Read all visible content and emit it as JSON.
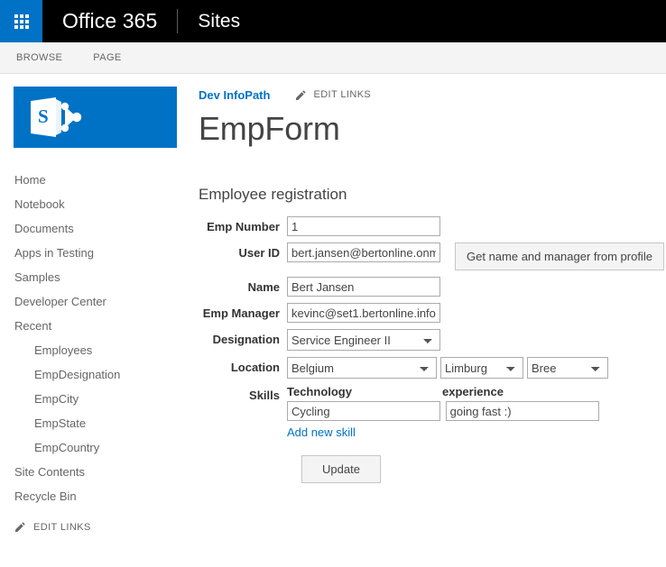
{
  "suite_bar": {
    "waffle_icon": "app-launcher-waffle-icon",
    "brand": "Office 365",
    "nav_item": "Sites"
  },
  "ribbon": {
    "tabs": [
      {
        "label": "BROWSE"
      },
      {
        "label": "PAGE"
      }
    ]
  },
  "logo": {
    "name": "sharepoint-logo",
    "letter": "S"
  },
  "sidebar": {
    "items": [
      {
        "label": "Home",
        "sub": false
      },
      {
        "label": "Notebook",
        "sub": false
      },
      {
        "label": "Documents",
        "sub": false
      },
      {
        "label": "Apps in Testing",
        "sub": false
      },
      {
        "label": "Samples",
        "sub": false
      },
      {
        "label": "Developer Center",
        "sub": false
      },
      {
        "label": "Recent",
        "sub": false
      },
      {
        "label": "Employees",
        "sub": true
      },
      {
        "label": "EmpDesignation",
        "sub": true
      },
      {
        "label": "EmpCity",
        "sub": true
      },
      {
        "label": "EmpState",
        "sub": true
      },
      {
        "label": "EmpCountry",
        "sub": true
      },
      {
        "label": "Site Contents",
        "sub": false
      },
      {
        "label": "Recycle Bin",
        "sub": false
      }
    ],
    "edit_links": "EDIT LINKS",
    "edit_links_icon": "pencil-icon"
  },
  "header": {
    "site_link": "Dev InfoPath",
    "edit_links": "EDIT LINKS",
    "edit_links_icon": "pencil-icon",
    "title": "EmpForm"
  },
  "form": {
    "section_title": "Employee registration",
    "fields": {
      "emp_number": {
        "label": "Emp Number",
        "value": "1"
      },
      "user_id": {
        "label": "User ID",
        "value": "bert.jansen@bertonline.onmi"
      },
      "name": {
        "label": "Name",
        "value": "Bert Jansen"
      },
      "emp_manager": {
        "label": "Emp Manager",
        "value": "kevinc@set1.bertonline.info"
      },
      "designation": {
        "label": "Designation",
        "value": "Service Engineer II"
      },
      "location": {
        "label": "Location",
        "country": "Belgium",
        "state": "Limburg",
        "city": "Bree"
      },
      "skills": {
        "label": "Skills",
        "col_technology": "Technology",
        "col_experience": "experience",
        "rows": [
          {
            "technology": "Cycling",
            "experience": "going fast :)"
          }
        ],
        "add_link": "Add new skill"
      }
    },
    "buttons": {
      "get_profile": "Get name and manager from profile",
      "update": "Update"
    }
  },
  "colors": {
    "accent_blue": "#0072c6",
    "suite_bar_bg": "#000000",
    "ribbon_bg": "#f4f4f4",
    "text_default": "#444444",
    "label_text": "#333333"
  }
}
